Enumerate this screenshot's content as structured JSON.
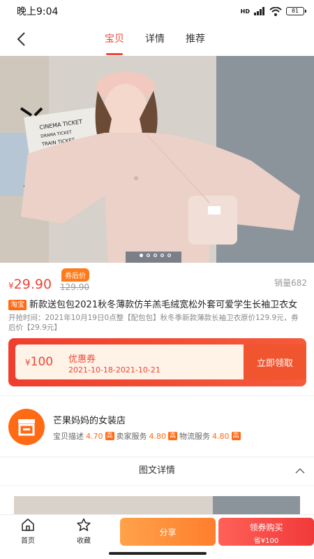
{
  "status_bar": {
    "time": "晚上9:04",
    "battery": "81",
    "network": "HD"
  },
  "nav": {
    "tabs": [
      "宝贝",
      "详情",
      "推荐"
    ],
    "active_tab": 0
  },
  "hero": {
    "image_text": {
      "line1": "CINEMA TICKET",
      "line2": "DRAMA TICKET",
      "line3": "TRAIN TICKET"
    },
    "dot_count": 5,
    "active_dot": 0
  },
  "product": {
    "coupon_tag": "券后价",
    "currency": "¥",
    "price": "29.90",
    "original_price": "129.90",
    "sales": "销量682",
    "platform": "淘宝",
    "title": "新款送包包2021秋冬薄款仿羊羔毛绒宽松外套可爱学生长袖卫衣女",
    "description": "开抢时间：2021年10月19日0点整【配包包】秋冬季新款薄款长袖卫衣原价129.9元，券后价【29.9元】"
  },
  "coupon": {
    "currency": "¥",
    "amount": "100",
    "label": "优惠券",
    "dates": "2021-10-18-2021-10-21",
    "action": "立即领取"
  },
  "shop": {
    "name": "芒果妈妈的女装店",
    "scores": [
      {
        "label": "宝贝描述",
        "value": "4.70",
        "badge": "高"
      },
      {
        "label": "卖家服务",
        "value": "4.80",
        "badge": "高"
      },
      {
        "label": "物流服务",
        "value": "4.80",
        "badge": "高"
      }
    ]
  },
  "section": {
    "title": "图文详情"
  },
  "bottom_bar": {
    "home": "首页",
    "favorite": "收藏",
    "share": "分享",
    "buy": "领券购买",
    "buy_sub": "省¥100"
  },
  "colors": {
    "accent": "#ef4638",
    "orange": "#ff6a14"
  }
}
